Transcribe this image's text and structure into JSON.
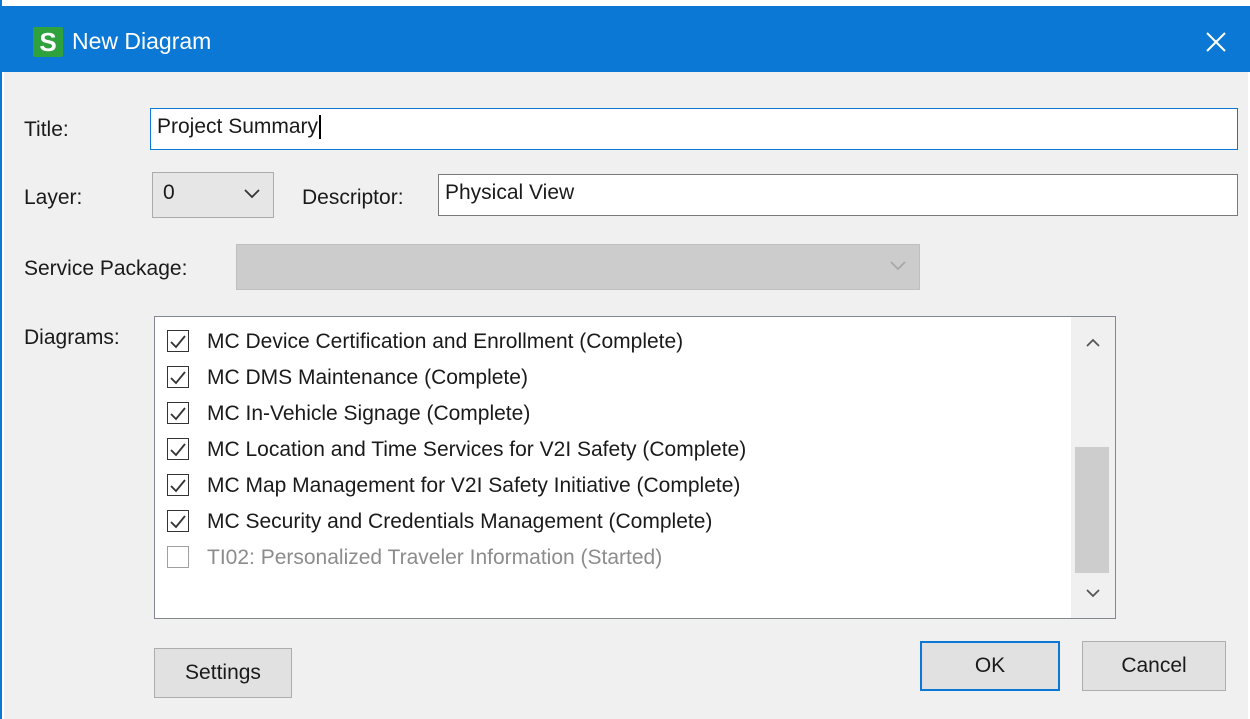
{
  "window": {
    "title": "New Diagram",
    "app_icon_letter": "S",
    "accent_color": "#0a78d4"
  },
  "form": {
    "title_label": "Title:",
    "title_value": "Project Summary",
    "layer_label": "Layer:",
    "layer_value": "0",
    "descriptor_label": "Descriptor:",
    "descriptor_value": "Physical View",
    "service_package_label": "Service Package:",
    "service_package_value": "",
    "diagrams_label": "Diagrams:"
  },
  "diagrams": [
    {
      "label": "MC Device Certification and Enrollment (Complete)",
      "checked": true,
      "enabled": true
    },
    {
      "label": "MC DMS Maintenance (Complete)",
      "checked": true,
      "enabled": true
    },
    {
      "label": "MC In-Vehicle Signage (Complete)",
      "checked": true,
      "enabled": true
    },
    {
      "label": "MC Location and Time Services for V2I Safety (Complete)",
      "checked": true,
      "enabled": true
    },
    {
      "label": "MC Map Management for V2I Safety Initiative (Complete)",
      "checked": true,
      "enabled": true
    },
    {
      "label": "MC Security and Credentials Management (Complete)",
      "checked": true,
      "enabled": true
    },
    {
      "label": "TI02: Personalized Traveler Information (Started)",
      "checked": false,
      "enabled": false
    }
  ],
  "buttons": {
    "settings": "Settings",
    "ok": "OK",
    "cancel": "Cancel"
  }
}
